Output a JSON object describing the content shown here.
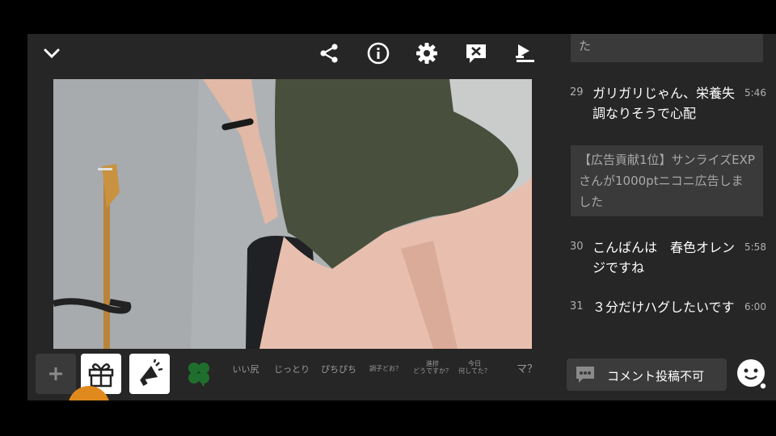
{
  "topbar": {
    "icons": [
      "chevron-down-icon",
      "share-icon",
      "info-icon",
      "gear-icon",
      "close-comment-icon",
      "download-icon"
    ]
  },
  "comments": {
    "notice_top": "た",
    "items": [
      {
        "num": "29",
        "text": "ガリガリじゃん、栄養失調なりそうで心配",
        "time": "5:46"
      },
      {
        "num": "30",
        "text": "こんばんは　春色オレンジですね",
        "time": "5:58"
      },
      {
        "num": "31",
        "text": "３分だけハグしたいです",
        "time": "6:00"
      }
    ],
    "ad_notice": "【広告貢献1位】サンライズEXPさんが1000ptニコニ広告しました"
  },
  "bottombar": {
    "reactions": [
      {
        "label": "いい尻"
      },
      {
        "label": "じっとり"
      },
      {
        "label": "ぴちぴち"
      },
      {
        "label": "調子どお？"
      },
      {
        "label": "進捗\nどうですか？"
      },
      {
        "label": "今日\n何してた？"
      },
      {
        "label": "マ？"
      }
    ]
  },
  "post": {
    "label": "コメント投稿不可"
  },
  "colors": {
    "background": "#262626",
    "panel": "#3a3a3a",
    "clover": "#1f6e2e",
    "orange": "#e08a1e"
  }
}
